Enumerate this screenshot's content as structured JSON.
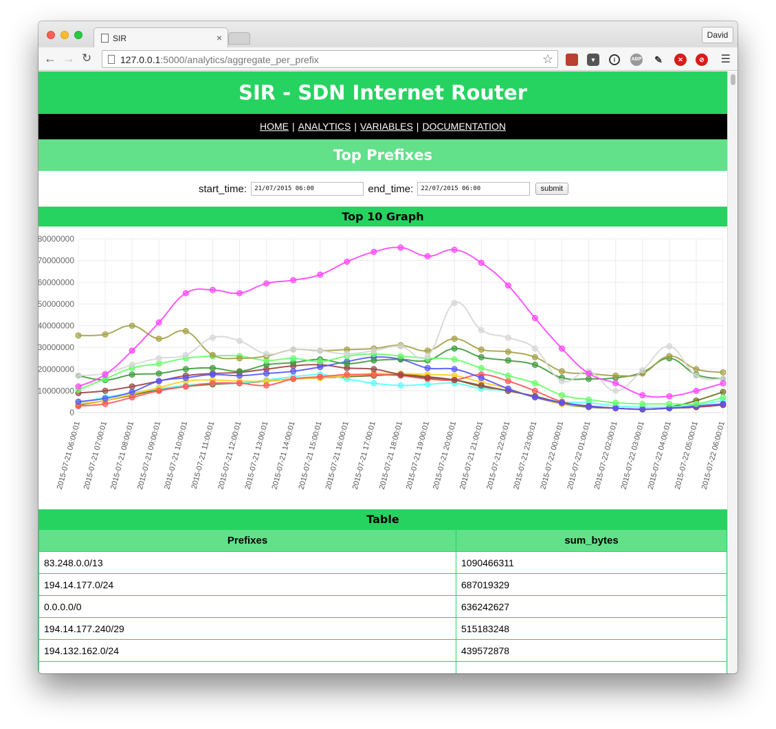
{
  "browser": {
    "tab_title": "SIR",
    "url_host": "127.0.0.1",
    "url_rest": ":5000/analytics/aggregate_per_prefix",
    "user_label": "David"
  },
  "site": {
    "title": "SIR - SDN Internet Router",
    "nav": [
      "HOME",
      "ANALYTICS",
      "VARIABLES",
      "DOCUMENTATION"
    ],
    "section_title": "Top Prefixes",
    "filter": {
      "start_label": "start_time:",
      "start_value": "21/07/2015 06:00",
      "end_label": "end_time:",
      "end_value": "22/07/2015 06:00",
      "submit_label": "submit"
    },
    "graph_title": "Top 10 Graph",
    "table_title": "Table"
  },
  "table": {
    "headers": [
      "Prefixes",
      "sum_bytes"
    ],
    "rows": [
      [
        "83.248.0.0/13",
        "1090466311"
      ],
      [
        "194.14.177.0/24",
        "687019329"
      ],
      [
        "0.0.0.0/0",
        "636242627"
      ],
      [
        "194.14.177.240/29",
        "515183248"
      ],
      [
        "194.132.162.0/24",
        "439572878"
      ]
    ]
  },
  "chart_data": {
    "type": "line",
    "x": [
      "2015-07-21 06:00:01",
      "2015-07-21 07:00:01",
      "2015-07-21 08:00:01",
      "2015-07-21 09:00:01",
      "2015-07-21 10:00:01",
      "2015-07-21 11:00:01",
      "2015-07-21 12:00:01",
      "2015-07-21 13:00:01",
      "2015-07-21 14:00:01",
      "2015-07-21 15:00:01",
      "2015-07-21 16:00:01",
      "2015-07-21 17:00:01",
      "2015-07-21 18:00:01",
      "2015-07-21 19:00:01",
      "2015-07-21 20:00:01",
      "2015-07-21 21:00:01",
      "2015-07-21 22:00:01",
      "2015-07-21 23:00:01",
      "2015-07-22 00:00:01",
      "2015-07-22 01:00:01",
      "2015-07-22 02:00:01",
      "2015-07-22 03:00:01",
      "2015-07-22 04:00:01",
      "2015-07-22 05:00:01",
      "2015-07-22 06:00:01"
    ],
    "yticks": [
      "0",
      "10000000",
      "20000000",
      "30000000",
      "40000000",
      "50000000",
      "60000000",
      "70000000",
      "80000000"
    ],
    "ylim": [
      0,
      80000000
    ],
    "grid": true,
    "series": [
      {
        "color": "#ff44ff",
        "values": [
          12000000,
          17500000,
          28500000,
          41500000,
          55000000,
          56500000,
          55000000,
          59500000,
          61000000,
          63500000,
          69500000,
          74000000,
          76000000,
          72000000,
          75000000,
          69000000,
          58500000,
          43500000,
          29500000,
          18000000,
          13500000,
          8000000,
          7500000,
          10000000,
          13500000
        ]
      },
      {
        "color": "#d6d6d6",
        "values": [
          17000000,
          18000000,
          22000000,
          25000000,
          26500000,
          34500000,
          33000000,
          27000000,
          29000000,
          28500000,
          27000000,
          28500000,
          30500000,
          26000000,
          50500000,
          38000000,
          34500000,
          29500000,
          14500000,
          19000000,
          10000000,
          19500000,
          30500000,
          17000000,
          15500000
        ]
      },
      {
        "color": "#a3a043",
        "values": [
          35500000,
          36000000,
          40000000,
          34000000,
          37500000,
          26500000,
          25000000,
          26000000,
          29000000,
          28500000,
          29000000,
          29500000,
          31000000,
          28500000,
          34000000,
          29000000,
          28000000,
          25500000,
          19000000,
          18000000,
          17000000,
          18000000,
          26000000,
          20000000,
          18500000
        ]
      },
      {
        "color": "#66ff66",
        "values": [
          10500000,
          15500000,
          20500000,
          22500000,
          25000000,
          26000000,
          26000000,
          24000000,
          25000000,
          23500000,
          26000000,
          27000000,
          26000000,
          25000000,
          24500000,
          20500000,
          17000000,
          13500000,
          8000000,
          6000000,
          4500000,
          4000000,
          4000000,
          4000000,
          7000000
        ]
      },
      {
        "color": "#3b9a3b",
        "values": [
          17000000,
          15000000,
          17500000,
          18000000,
          20000000,
          20500000,
          19000000,
          22000000,
          23000000,
          24500000,
          22500000,
          24000000,
          24500000,
          24000000,
          29500000,
          25500000,
          24000000,
          22000000,
          16000000,
          15500000,
          16000000,
          18500000,
          25000000,
          17500000,
          15500000
        ]
      },
      {
        "color": "#5555ff",
        "values": [
          5000000,
          6500000,
          9500000,
          14500000,
          16000000,
          17500000,
          17000000,
          18000000,
          19000000,
          21000000,
          23500000,
          25500000,
          24500000,
          20500000,
          20000000,
          16000000,
          11000000,
          7000000,
          4500000,
          3000000,
          2000000,
          1500000,
          2000000,
          3000000,
          4000000
        ]
      },
      {
        "color": "#994444",
        "values": [
          9000000,
          10000000,
          12000000,
          14500000,
          17000000,
          18000000,
          18500000,
          20000000,
          21500000,
          22000000,
          20500000,
          20000000,
          17500000,
          16000000,
          15000000,
          12500000,
          10000000,
          7500000,
          4500000,
          3000000,
          2000000,
          1500000,
          2000000,
          2500000,
          3500000
        ]
      },
      {
        "color": "#ff5555",
        "values": [
          3000000,
          4000000,
          7000000,
          10000000,
          12000000,
          13500000,
          13500000,
          12500000,
          15500000,
          16500000,
          17500000,
          17500000,
          17000000,
          15500000,
          15000000,
          17500000,
          14500000,
          10000000,
          5000000,
          3000000,
          2000000,
          1500000,
          2000000,
          2500000,
          3500000
        ]
      },
      {
        "color": "#ffcc22",
        "values": [
          4000000,
          5500000,
          8500000,
          11500000,
          14500000,
          15000000,
          14500000,
          14500000,
          15500000,
          16000000,
          17000000,
          18000000,
          18000000,
          17500000,
          17000000,
          14000000,
          11000000,
          7000000,
          4000000,
          3000000,
          2000000,
          1500000,
          2000000,
          3000000,
          4000000
        ]
      },
      {
        "color": "#55ffff",
        "values": [
          4500000,
          7000000,
          9000000,
          11000000,
          12500000,
          13500000,
          13500000,
          15000000,
          16500000,
          17500000,
          15500000,
          13500000,
          12500000,
          13000000,
          13500000,
          11000000,
          10000000,
          7500000,
          5000000,
          4500000,
          3000000,
          2500000,
          2500000,
          3500000,
          5500000
        ]
      },
      {
        "color": "#6b6b1f",
        "values": [
          3500000,
          5500000,
          8000000,
          10500000,
          12000000,
          13000000,
          13500000,
          14500000,
          15500000,
          16000000,
          16500000,
          17000000,
          17500000,
          16500000,
          15000000,
          12000000,
          10000000,
          7500000,
          4000000,
          2500000,
          2000000,
          1500000,
          2500000,
          5500000,
          9500000
        ]
      }
    ]
  }
}
